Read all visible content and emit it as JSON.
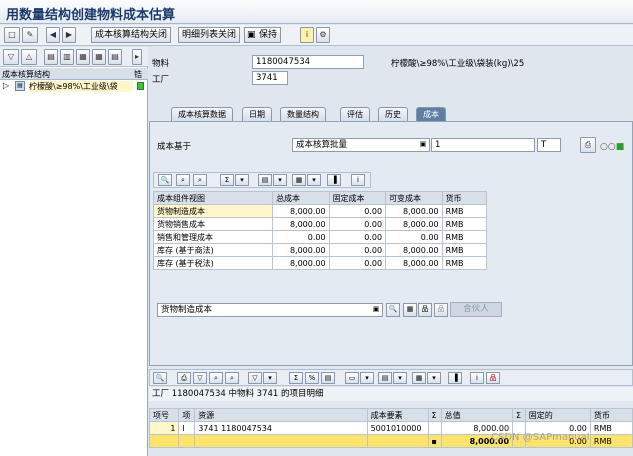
{
  "window": {
    "title": "用数量结构创建物料成本估算"
  },
  "toolbar": {
    "btn1": "成本核算结构关闭",
    "btn2": "明细列表关闭",
    "save": "保持"
  },
  "tree": {
    "header": "成本核算结构",
    "header_right": "锆",
    "item": "柠檬酸\\≥98%\\工业级\\袋"
  },
  "material": {
    "label": "物料",
    "value": "1180047534",
    "desc": "柠檬酸\\≥98%\\工业级\\袋装(kg)\\25",
    "plant_label": "工厂",
    "plant_value": "3741"
  },
  "tabs": [
    "成本核算数据",
    "日期",
    "数量结构",
    "评估",
    "历史",
    "成本"
  ],
  "cost_basis": {
    "label": "成本基于",
    "value": "成本核算批量",
    "qty": "1",
    "unit": "T"
  },
  "cost_table": {
    "headers": [
      "成本组件视图",
      "总成本",
      "固定成本",
      "可变成本",
      "货币"
    ],
    "rows": [
      [
        "货物制造成本",
        "8,000.00",
        "0.00",
        "8,000.00",
        "RMB"
      ],
      [
        "货物销售成本",
        "8,000.00",
        "0.00",
        "8,000.00",
        "RMB"
      ],
      [
        "销售和管理成本",
        "0.00",
        "0.00",
        "0.00",
        "RMB"
      ],
      [
        "库存 (基于商法)",
        "8,000.00",
        "0.00",
        "8,000.00",
        "RMB"
      ],
      [
        "库存 (基于税法)",
        "8,000.00",
        "0.00",
        "8,000.00",
        "RMB"
      ]
    ]
  },
  "view_select": {
    "value": "货物制造成本",
    "button": "合伙人"
  },
  "itemization": {
    "title": "工厂 1180047534 中物料 3741 的项目明细",
    "headers": [
      "项号",
      "项",
      "资源",
      "成本要素",
      "Σ",
      "总值",
      "Σ",
      "固定的",
      "货币"
    ],
    "rows": [
      [
        "1",
        "I",
        "3741 1180047534",
        "5001010000",
        "",
        "8,000.00",
        "",
        "0.00",
        "RMB"
      ]
    ],
    "total_marker": "▪",
    "total_value": "8,000.00",
    "total_fixed": "0.00",
    "total_currency": "RMB",
    "watermark": "CSDN @SAPmanual"
  },
  "colors": {
    "accent": "#5f7ea3",
    "selected": "#fff6c9",
    "total": "#ffe36a"
  }
}
